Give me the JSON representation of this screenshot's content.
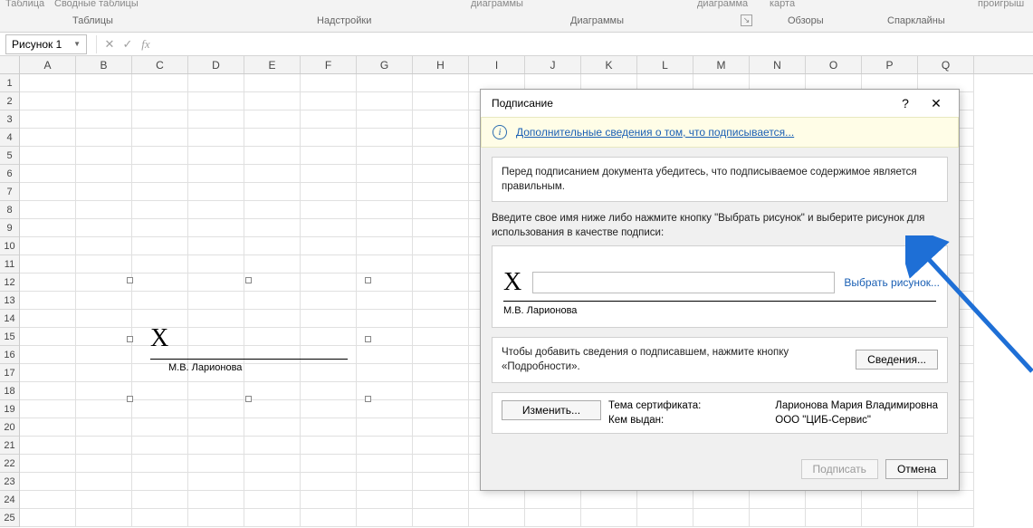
{
  "ribbon": {
    "cut_top_left": "Таблица",
    "cut_top_left2": "Сводные таблицы",
    "cut_top_mid": "диаграммы",
    "cut_top_mid2": "диаграмма",
    "cut_top_right": "карта",
    "cut_top_right2": "проигрыш",
    "group_tables": "Таблицы",
    "group_addons": "Надстройки",
    "group_charts": "Диаграммы",
    "group_reviews": "Обзоры",
    "group_sparklines": "Спарклайны"
  },
  "namebar": {
    "namebox": "Рисунок 1",
    "fx": "fx"
  },
  "columns": [
    "A",
    "B",
    "C",
    "D",
    "E",
    "F",
    "G",
    "H",
    "I",
    "J",
    "K",
    "L",
    "M",
    "N",
    "O",
    "P",
    "Q"
  ],
  "rows": [
    "1",
    "2",
    "3",
    "4",
    "5",
    "6",
    "7",
    "8",
    "9",
    "10",
    "11",
    "12",
    "13",
    "14",
    "15",
    "16",
    "17",
    "18",
    "19",
    "20",
    "21",
    "22",
    "23",
    "24",
    "25"
  ],
  "sheet_signature": {
    "x": "X",
    "name": "М.В. Ларионова"
  },
  "dialog": {
    "title": "Подписание",
    "help": "?",
    "close": "✕",
    "info_link": "Дополнительные сведения о том, что подписывается...",
    "warn_text": "Перед подписанием документа убедитесь, что подписываемое содержимое является правильным.",
    "instr_text": "Введите свое имя ниже либо нажмите кнопку \"Выбрать рисунок\" и выберите рисунок для использования в качестве подписи:",
    "big_x": "X",
    "pick_image": "Выбрать рисунок...",
    "signer_name": "М.В. Ларионова",
    "details_text": "Чтобы добавить сведения о подписавшем, нажмите кнопку «Подробности».",
    "details_btn": "Сведения...",
    "cert_subject_label": "Тема сертификата:",
    "cert_subject": "Ларионова Мария Владимировна",
    "cert_issuer_label": "Кем выдан:",
    "cert_issuer": "ООО \"ЦИБ-Сервис\"",
    "change_btn": "Изменить...",
    "sign_btn": "Подписать",
    "cancel_btn": "Отмена"
  }
}
